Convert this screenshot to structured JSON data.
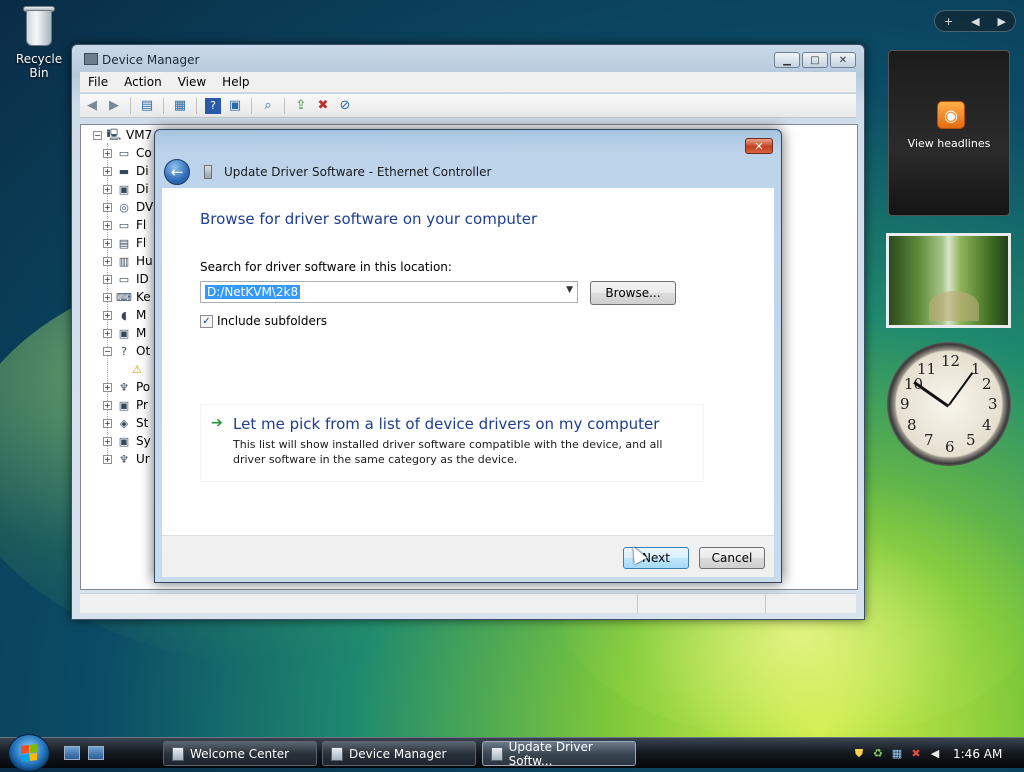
{
  "desktop": {
    "recycle_bin_label": "Recycle Bin"
  },
  "device_manager": {
    "title": "Device Manager",
    "menu": [
      "File",
      "Action",
      "View",
      "Help"
    ],
    "tree_root": "VM7",
    "tree_items": [
      "Co",
      "Di",
      "Di",
      "DV",
      "Fl",
      "Fl",
      "Hu",
      "ID",
      "Ke",
      "M",
      "M",
      "Ot",
      "",
      "Po",
      "Pr",
      "St",
      "Sy",
      "Ur"
    ]
  },
  "dialog": {
    "title": "Update Driver Software - Ethernet Controller",
    "close_label": "✕",
    "heading": "Browse for driver software on your computer",
    "search_label": "Search for driver software in this location:",
    "search_value": "D:/NetKVM\\2k8",
    "browse_label": "Browse...",
    "include_subfolders_label": "Include subfolders",
    "include_subfolders_checked": true,
    "pick_title": "Let me pick from a list of device drivers on my computer",
    "pick_description": "This list will show installed driver software compatible with the device, and all driver software in the same category as the device.",
    "next_label": "Next",
    "cancel_label": "Cancel"
  },
  "sidebar": {
    "feed_label": "View headlines",
    "clock_numbers": [
      "12",
      "1",
      "2",
      "3",
      "4",
      "5",
      "6",
      "7",
      "8",
      "9",
      "10",
      "11"
    ]
  },
  "taskbar": {
    "tasks": [
      "Welcome Center",
      "Device Manager",
      "Update Driver Softw..."
    ],
    "active_task_index": 2,
    "time": "1:46 AM"
  },
  "colors": {
    "heading_blue": "#1e3f8f",
    "selection_blue": "#3399ff",
    "close_red": "#c3401f",
    "rss_orange": "#e46b0e"
  },
  "icons": {
    "toolbar": [
      "back-arrow-icon",
      "forward-arrow-icon",
      "console-tree-icon",
      "properties-icon",
      "help-icon",
      "view-icon",
      "scan-hardware-icon",
      "update-driver-icon",
      "uninstall-icon",
      "disable-icon"
    ]
  }
}
